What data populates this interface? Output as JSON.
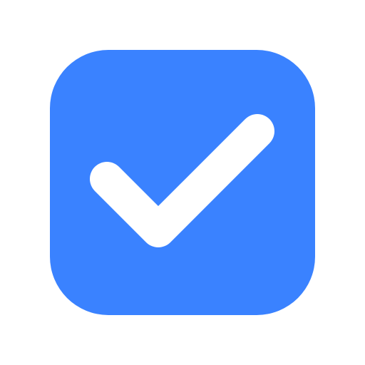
{
  "checkbox": {
    "checked": true,
    "icon": "checkmark-icon",
    "fill_color": "#3a82ff",
    "mark_color": "#ffffff"
  }
}
